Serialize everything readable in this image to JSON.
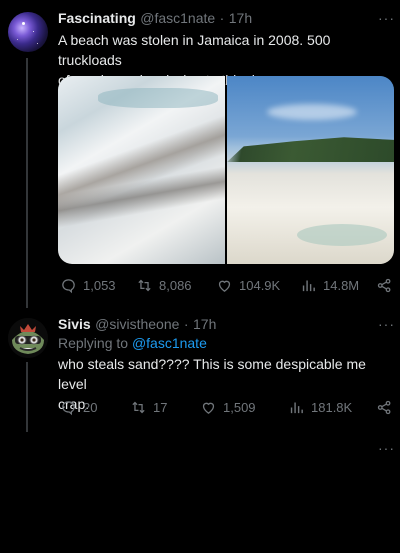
{
  "tweet": {
    "author_name": "Fascinating",
    "handle": "@fasc1nate",
    "time": "17h",
    "text_line1": "A beach was stolen in Jamaica in 2008.  500 truckloads",
    "text_line2": "of sand remain missing to this day.",
    "replies": "1,053",
    "retweets": "8,086",
    "likes": "104.9K",
    "views": "14.8M"
  },
  "reply": {
    "author_name": "Sivis",
    "handle": "@sivistheone",
    "time": "17h",
    "replying_prefix": "Replying to",
    "replying_to": "@fasc1nate",
    "text_line1": "who steals sand???? This is some despicable me level",
    "text_line2": "crap.",
    "replies": "20",
    "retweets": "17",
    "likes": "1,509",
    "views": "181.8K"
  },
  "more_glyph": "···",
  "separator": "·",
  "colors": {
    "background": "#000000",
    "link": "#1d9bf0",
    "muted": "#71767b",
    "text": "#e7e9ea"
  }
}
